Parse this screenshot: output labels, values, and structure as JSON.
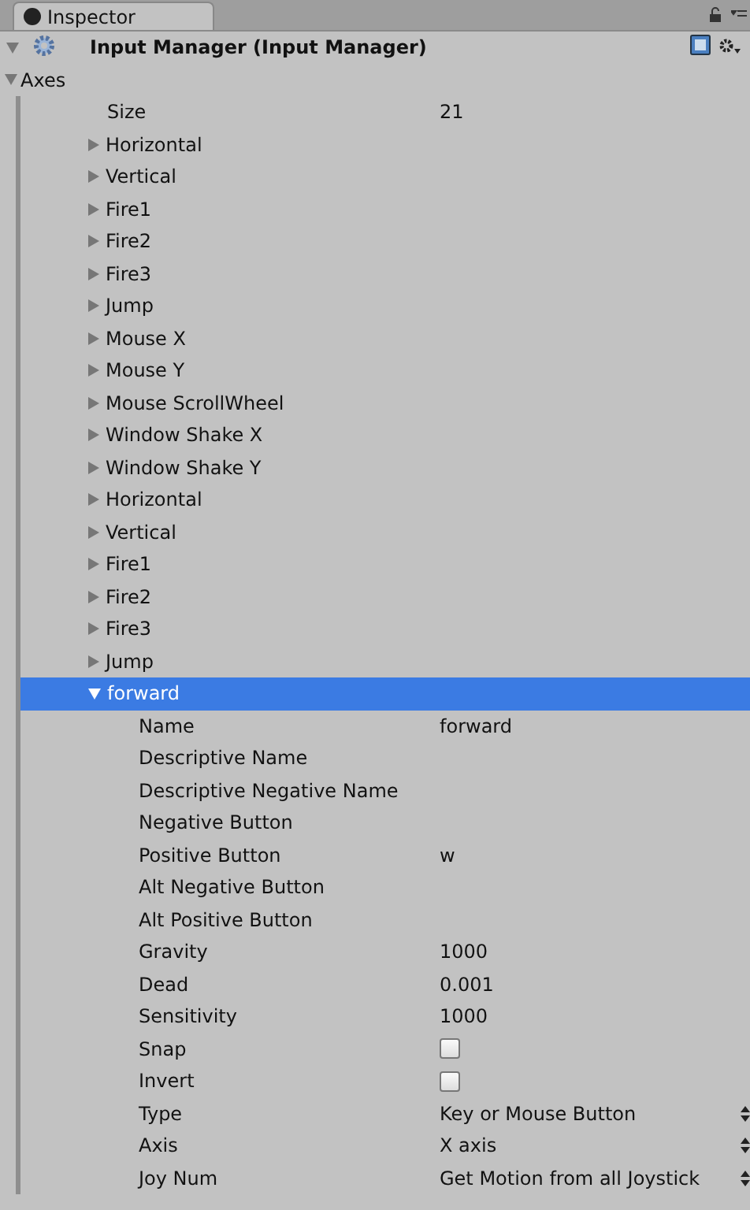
{
  "tab": {
    "label": "Inspector",
    "selected": true
  },
  "component": {
    "title": "Input Manager (Input Manager)",
    "expanded": true
  },
  "axes": {
    "label": "Axes",
    "expanded": true,
    "size_label": "Size",
    "size_value": "21",
    "elements": [
      {
        "label": "Horizontal",
        "expanded": false,
        "selected": false
      },
      {
        "label": "Vertical",
        "expanded": false,
        "selected": false
      },
      {
        "label": "Fire1",
        "expanded": false,
        "selected": false
      },
      {
        "label": "Fire2",
        "expanded": false,
        "selected": false
      },
      {
        "label": "Fire3",
        "expanded": false,
        "selected": false
      },
      {
        "label": "Jump",
        "expanded": false,
        "selected": false
      },
      {
        "label": "Mouse X",
        "expanded": false,
        "selected": false
      },
      {
        "label": "Mouse Y",
        "expanded": false,
        "selected": false
      },
      {
        "label": "Mouse ScrollWheel",
        "expanded": false,
        "selected": false
      },
      {
        "label": "Window Shake X",
        "expanded": false,
        "selected": false
      },
      {
        "label": "Window Shake Y",
        "expanded": false,
        "selected": false
      },
      {
        "label": "Horizontal",
        "expanded": false,
        "selected": false
      },
      {
        "label": "Vertical",
        "expanded": false,
        "selected": false
      },
      {
        "label": "Fire1",
        "expanded": false,
        "selected": false
      },
      {
        "label": "Fire2",
        "expanded": false,
        "selected": false
      },
      {
        "label": "Fire3",
        "expanded": false,
        "selected": false
      },
      {
        "label": "Jump",
        "expanded": false,
        "selected": false
      },
      {
        "label": "forward",
        "expanded": true,
        "selected": true,
        "fields": [
          {
            "kind": "text",
            "label": "Name",
            "value": "forward"
          },
          {
            "kind": "text",
            "label": "Descriptive Name"
          },
          {
            "kind": "text",
            "label": "Descriptive Negative Name"
          },
          {
            "kind": "text",
            "label": "Negative Button"
          },
          {
            "kind": "text",
            "label": "Positive Button",
            "value": "w"
          },
          {
            "kind": "text",
            "label": "Alt Negative Button"
          },
          {
            "kind": "text",
            "label": "Alt Positive Button"
          },
          {
            "kind": "text",
            "label": "Gravity",
            "value": "1000"
          },
          {
            "kind": "text",
            "label": "Dead",
            "value": "0.001"
          },
          {
            "kind": "text",
            "label": "Sensitivity",
            "value": "1000"
          },
          {
            "kind": "checkbox",
            "label": "Snap",
            "checked": false
          },
          {
            "kind": "checkbox",
            "label": "Invert",
            "checked": false
          },
          {
            "kind": "dropdown",
            "label": "Type",
            "value": "Key or Mouse Button"
          },
          {
            "kind": "dropdown",
            "label": "Axis",
            "value": "X axis"
          },
          {
            "kind": "dropdown",
            "label": "Joy Num",
            "value": "Get Motion from all Joystick"
          }
        ]
      }
    ]
  }
}
